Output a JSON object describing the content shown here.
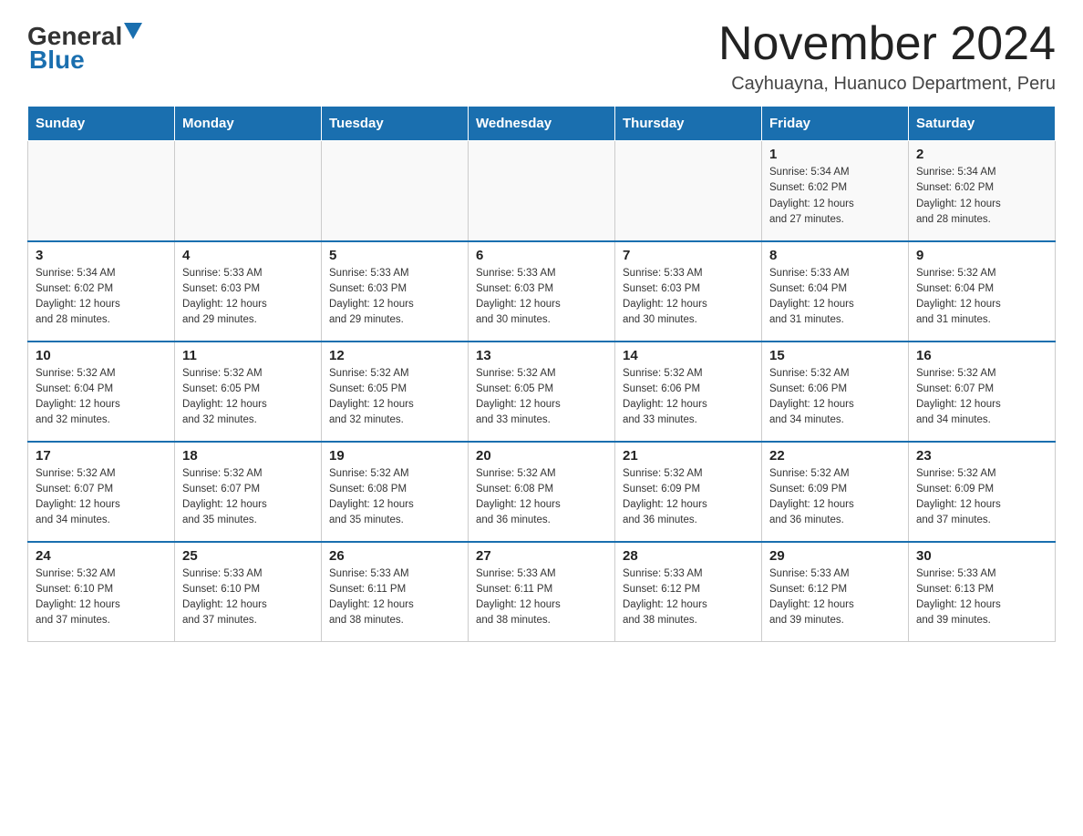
{
  "logo": {
    "general": "General",
    "blue": "Blue",
    "triangle": "▼"
  },
  "title": "November 2024",
  "location": "Cayhuayna, Huanuco Department, Peru",
  "weekdays": [
    "Sunday",
    "Monday",
    "Tuesday",
    "Wednesday",
    "Thursday",
    "Friday",
    "Saturday"
  ],
  "rows": [
    [
      {
        "day": "",
        "info": ""
      },
      {
        "day": "",
        "info": ""
      },
      {
        "day": "",
        "info": ""
      },
      {
        "day": "",
        "info": ""
      },
      {
        "day": "",
        "info": ""
      },
      {
        "day": "1",
        "info": "Sunrise: 5:34 AM\nSunset: 6:02 PM\nDaylight: 12 hours\nand 27 minutes."
      },
      {
        "day": "2",
        "info": "Sunrise: 5:34 AM\nSunset: 6:02 PM\nDaylight: 12 hours\nand 28 minutes."
      }
    ],
    [
      {
        "day": "3",
        "info": "Sunrise: 5:34 AM\nSunset: 6:02 PM\nDaylight: 12 hours\nand 28 minutes."
      },
      {
        "day": "4",
        "info": "Sunrise: 5:33 AM\nSunset: 6:03 PM\nDaylight: 12 hours\nand 29 minutes."
      },
      {
        "day": "5",
        "info": "Sunrise: 5:33 AM\nSunset: 6:03 PM\nDaylight: 12 hours\nand 29 minutes."
      },
      {
        "day": "6",
        "info": "Sunrise: 5:33 AM\nSunset: 6:03 PM\nDaylight: 12 hours\nand 30 minutes."
      },
      {
        "day": "7",
        "info": "Sunrise: 5:33 AM\nSunset: 6:03 PM\nDaylight: 12 hours\nand 30 minutes."
      },
      {
        "day": "8",
        "info": "Sunrise: 5:33 AM\nSunset: 6:04 PM\nDaylight: 12 hours\nand 31 minutes."
      },
      {
        "day": "9",
        "info": "Sunrise: 5:32 AM\nSunset: 6:04 PM\nDaylight: 12 hours\nand 31 minutes."
      }
    ],
    [
      {
        "day": "10",
        "info": "Sunrise: 5:32 AM\nSunset: 6:04 PM\nDaylight: 12 hours\nand 32 minutes."
      },
      {
        "day": "11",
        "info": "Sunrise: 5:32 AM\nSunset: 6:05 PM\nDaylight: 12 hours\nand 32 minutes."
      },
      {
        "day": "12",
        "info": "Sunrise: 5:32 AM\nSunset: 6:05 PM\nDaylight: 12 hours\nand 32 minutes."
      },
      {
        "day": "13",
        "info": "Sunrise: 5:32 AM\nSunset: 6:05 PM\nDaylight: 12 hours\nand 33 minutes."
      },
      {
        "day": "14",
        "info": "Sunrise: 5:32 AM\nSunset: 6:06 PM\nDaylight: 12 hours\nand 33 minutes."
      },
      {
        "day": "15",
        "info": "Sunrise: 5:32 AM\nSunset: 6:06 PM\nDaylight: 12 hours\nand 34 minutes."
      },
      {
        "day": "16",
        "info": "Sunrise: 5:32 AM\nSunset: 6:07 PM\nDaylight: 12 hours\nand 34 minutes."
      }
    ],
    [
      {
        "day": "17",
        "info": "Sunrise: 5:32 AM\nSunset: 6:07 PM\nDaylight: 12 hours\nand 34 minutes."
      },
      {
        "day": "18",
        "info": "Sunrise: 5:32 AM\nSunset: 6:07 PM\nDaylight: 12 hours\nand 35 minutes."
      },
      {
        "day": "19",
        "info": "Sunrise: 5:32 AM\nSunset: 6:08 PM\nDaylight: 12 hours\nand 35 minutes."
      },
      {
        "day": "20",
        "info": "Sunrise: 5:32 AM\nSunset: 6:08 PM\nDaylight: 12 hours\nand 36 minutes."
      },
      {
        "day": "21",
        "info": "Sunrise: 5:32 AM\nSunset: 6:09 PM\nDaylight: 12 hours\nand 36 minutes."
      },
      {
        "day": "22",
        "info": "Sunrise: 5:32 AM\nSunset: 6:09 PM\nDaylight: 12 hours\nand 36 minutes."
      },
      {
        "day": "23",
        "info": "Sunrise: 5:32 AM\nSunset: 6:09 PM\nDaylight: 12 hours\nand 37 minutes."
      }
    ],
    [
      {
        "day": "24",
        "info": "Sunrise: 5:32 AM\nSunset: 6:10 PM\nDaylight: 12 hours\nand 37 minutes."
      },
      {
        "day": "25",
        "info": "Sunrise: 5:33 AM\nSunset: 6:10 PM\nDaylight: 12 hours\nand 37 minutes."
      },
      {
        "day": "26",
        "info": "Sunrise: 5:33 AM\nSunset: 6:11 PM\nDaylight: 12 hours\nand 38 minutes."
      },
      {
        "day": "27",
        "info": "Sunrise: 5:33 AM\nSunset: 6:11 PM\nDaylight: 12 hours\nand 38 minutes."
      },
      {
        "day": "28",
        "info": "Sunrise: 5:33 AM\nSunset: 6:12 PM\nDaylight: 12 hours\nand 38 minutes."
      },
      {
        "day": "29",
        "info": "Sunrise: 5:33 AM\nSunset: 6:12 PM\nDaylight: 12 hours\nand 39 minutes."
      },
      {
        "day": "30",
        "info": "Sunrise: 5:33 AM\nSunset: 6:13 PM\nDaylight: 12 hours\nand 39 minutes."
      }
    ]
  ]
}
